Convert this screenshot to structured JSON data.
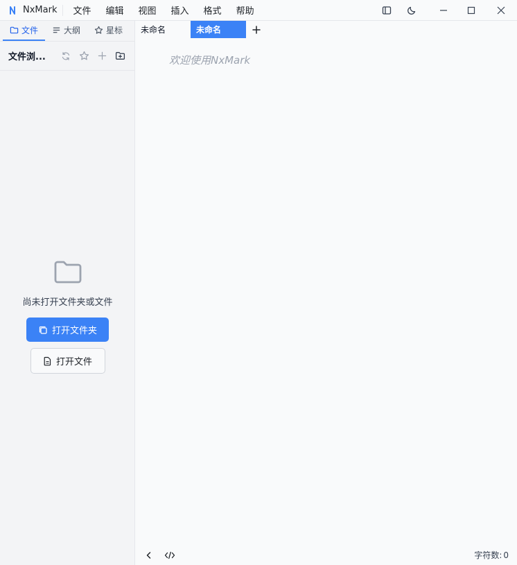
{
  "app": {
    "name": "NxMark"
  },
  "menu": [
    "文件",
    "编辑",
    "视图",
    "插入",
    "格式",
    "帮助"
  ],
  "sidebar": {
    "tabs": [
      {
        "label": "文件",
        "icon": "folder-icon",
        "active": true
      },
      {
        "label": "大纲",
        "icon": "outline-icon",
        "active": false
      },
      {
        "label": "星标",
        "icon": "star-icon",
        "active": false
      }
    ],
    "header_title": "文件浏...",
    "empty_text": "尚未打开文件夹或文件",
    "open_folder_label": "打开文件夹",
    "open_file_label": "打开文件"
  },
  "editor": {
    "tabs": [
      {
        "label": "未命名",
        "active": false
      },
      {
        "label": "未命名",
        "active": true
      }
    ],
    "placeholder": "欢迎使用NxMark"
  },
  "status": {
    "char_count_label": "字符数:",
    "char_count_value": "0"
  },
  "colors": {
    "accent": "#3b82f6",
    "sidebar_bg": "#f3f4f6",
    "editor_bg": "#f9fafb"
  }
}
